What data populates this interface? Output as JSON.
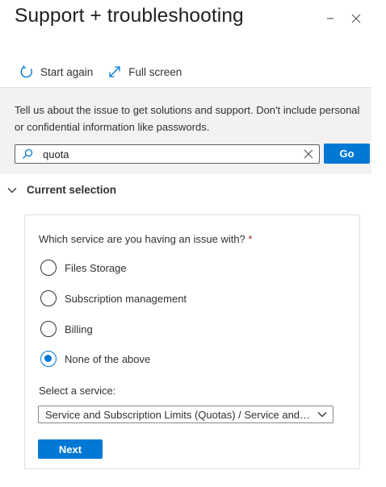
{
  "header": {
    "title": "Support + troubleshooting",
    "minimize_icon": "minimize-icon",
    "close_icon": "close-icon"
  },
  "toolbar": {
    "start_again_label": "Start again",
    "full_screen_label": "Full screen"
  },
  "info": {
    "text": "Tell us about the issue to get solutions and support. Don't include personal or confidential information like passwords."
  },
  "search": {
    "value": "quota",
    "go_label": "Go"
  },
  "section": {
    "title": "Current selection"
  },
  "form": {
    "question": "Which service are you having an issue with?",
    "required_marker": "*",
    "options": [
      {
        "label": "Files Storage",
        "checked": false
      },
      {
        "label": "Subscription management",
        "checked": false
      },
      {
        "label": "Billing",
        "checked": false
      },
      {
        "label": "None of the above",
        "checked": true
      }
    ],
    "select_label": "Select a service:",
    "select_value": "Service and Subscription Limits (Quotas) / Service and s...",
    "next_label": "Next"
  },
  "colors": {
    "accent": "#0078d4",
    "band_background": "#f3f2f1",
    "text": "#323130"
  }
}
